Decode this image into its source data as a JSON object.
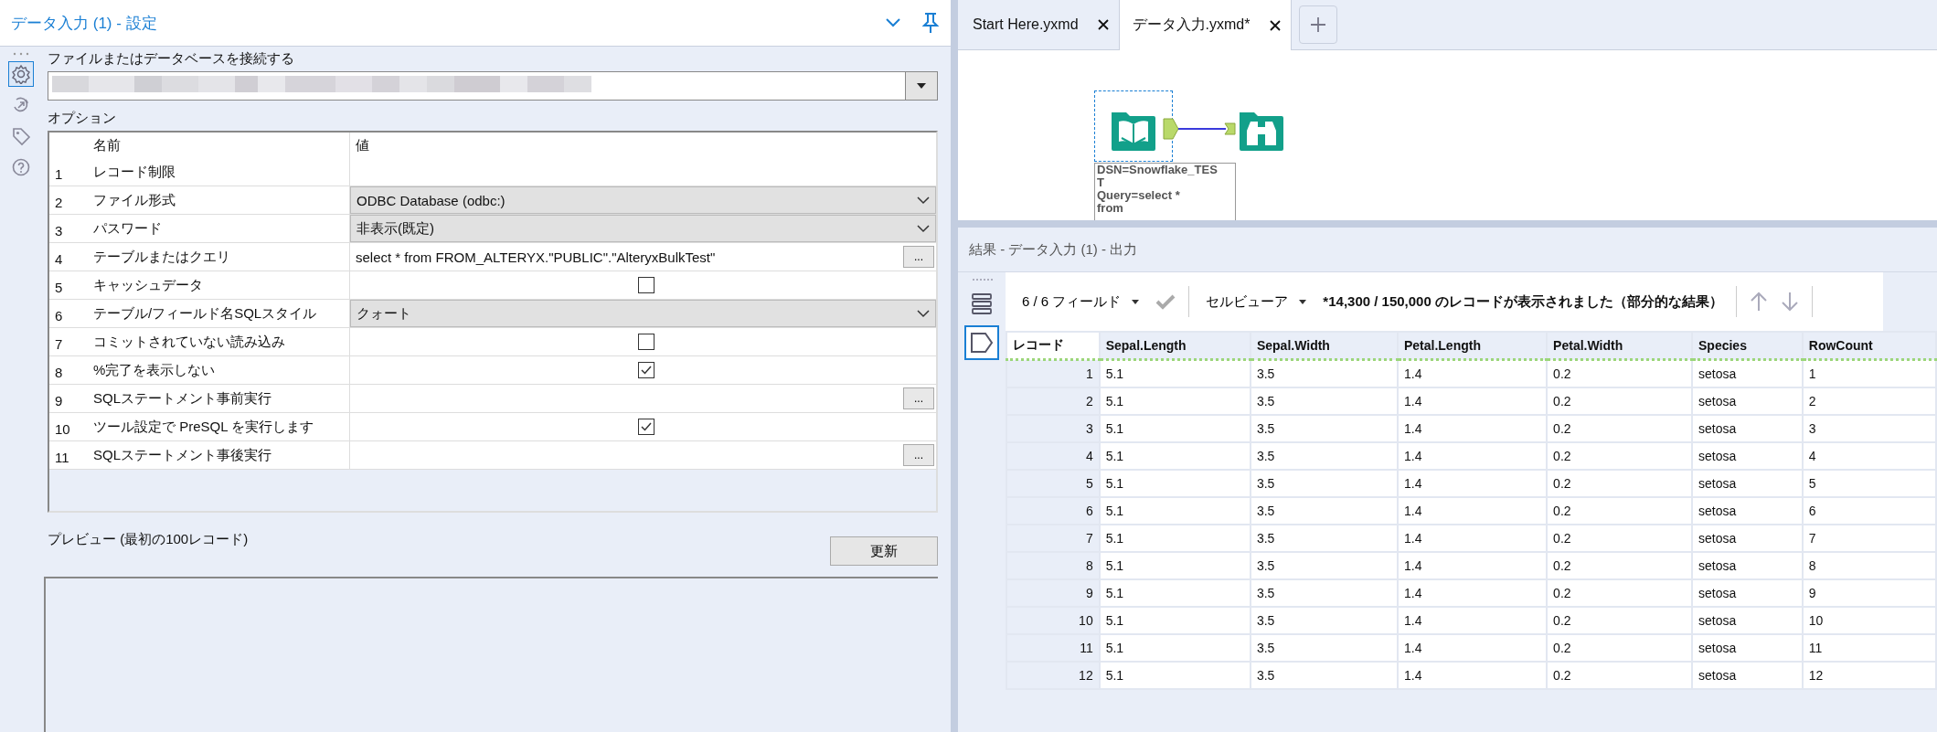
{
  "settings_panel": {
    "title": "データ入力 (1) - 設定",
    "side_tools": [
      {
        "kind": "gear",
        "selected": true
      },
      {
        "kind": "connection",
        "selected": false
      },
      {
        "kind": "tag",
        "selected": false
      },
      {
        "kind": "help",
        "selected": false
      }
    ],
    "connect_label": "ファイルまたはデータベースを接続する",
    "options_label": "オプション",
    "options_table": {
      "columns": [
        "名前",
        "値"
      ],
      "rows": [
        {
          "number": "1",
          "name": "レコード制限",
          "kind": "blank"
        },
        {
          "number": "2",
          "name": "ファイル形式",
          "kind": "dropdown",
          "value": "ODBC Database (odbc:)"
        },
        {
          "number": "3",
          "name": "パスワード",
          "kind": "dropdown",
          "value": "非表示(既定)"
        },
        {
          "number": "4",
          "name": "テーブルまたはクエリ",
          "kind": "text",
          "value": "select * from FROM_ALTERYX.\"PUBLIC\".\"AlteryxBulkTest\"",
          "button": "..."
        },
        {
          "number": "5",
          "name": "キャッシュデータ",
          "kind": "checkbox",
          "checked": false
        },
        {
          "number": "6",
          "name": "テーブル/フィールド名SQLスタイル",
          "kind": "dropdown",
          "value": "クォート"
        },
        {
          "number": "7",
          "name": "コミットされていない読み込み",
          "kind": "checkbox",
          "checked": false
        },
        {
          "number": "8",
          "name": "%完了を表示しない",
          "kind": "checkbox",
          "checked": true
        },
        {
          "number": "9",
          "name": "SQLステートメント事前実行",
          "kind": "text",
          "button": "..."
        },
        {
          "number": "10",
          "name": "ツール設定で PreSQL を実行します",
          "kind": "checkbox",
          "checked": true
        },
        {
          "number": "11",
          "name": "SQLステートメント事後実行",
          "kind": "text",
          "button": "..."
        }
      ]
    },
    "preview_label": "プレビュー (最初の100レコード)",
    "refresh_button": "更新"
  },
  "workflow": {
    "tabs": [
      {
        "label": "Start Here.yxmd",
        "selected": false
      },
      {
        "label": "データ入力.yxmd*",
        "selected": true
      }
    ],
    "annotation": [
      "DSN=Snowflake_TES",
      "T",
      "Query=select *",
      "from"
    ]
  },
  "results": {
    "title": "結果 - データ入力 (1) - 出力",
    "view_modes": [
      {
        "kind": "list",
        "selected": false
      },
      {
        "kind": "tag",
        "selected": true
      }
    ],
    "fields_selector": "6 / 6 フィールド",
    "viewer_selector": "セルビューア",
    "message": "*14,300 / 150,000 のレコードが表示されました（部分的な結果）",
    "table": {
      "columns": [
        "レコード",
        "Sepal.Length",
        "Sepal.Width",
        "Petal.Length",
        "Petal.Width",
        "Species",
        "RowCount"
      ],
      "rows": [
        [
          "1",
          "5.1",
          "3.5",
          "1.4",
          "0.2",
          "setosa",
          "1"
        ],
        [
          "2",
          "5.1",
          "3.5",
          "1.4",
          "0.2",
          "setosa",
          "2"
        ],
        [
          "3",
          "5.1",
          "3.5",
          "1.4",
          "0.2",
          "setosa",
          "3"
        ],
        [
          "4",
          "5.1",
          "3.5",
          "1.4",
          "0.2",
          "setosa",
          "4"
        ],
        [
          "5",
          "5.1",
          "3.5",
          "1.4",
          "0.2",
          "setosa",
          "5"
        ],
        [
          "6",
          "5.1",
          "3.5",
          "1.4",
          "0.2",
          "setosa",
          "6"
        ],
        [
          "7",
          "5.1",
          "3.5",
          "1.4",
          "0.2",
          "setosa",
          "7"
        ],
        [
          "8",
          "5.1",
          "3.5",
          "1.4",
          "0.2",
          "setosa",
          "8"
        ],
        [
          "9",
          "5.1",
          "3.5",
          "1.4",
          "0.2",
          "setosa",
          "9"
        ],
        [
          "10",
          "5.1",
          "3.5",
          "1.4",
          "0.2",
          "setosa",
          "10"
        ],
        [
          "11",
          "5.1",
          "3.5",
          "1.4",
          "0.2",
          "setosa",
          "11"
        ],
        [
          "12",
          "5.1",
          "3.5",
          "1.4",
          "0.2",
          "setosa",
          "12"
        ]
      ]
    }
  }
}
